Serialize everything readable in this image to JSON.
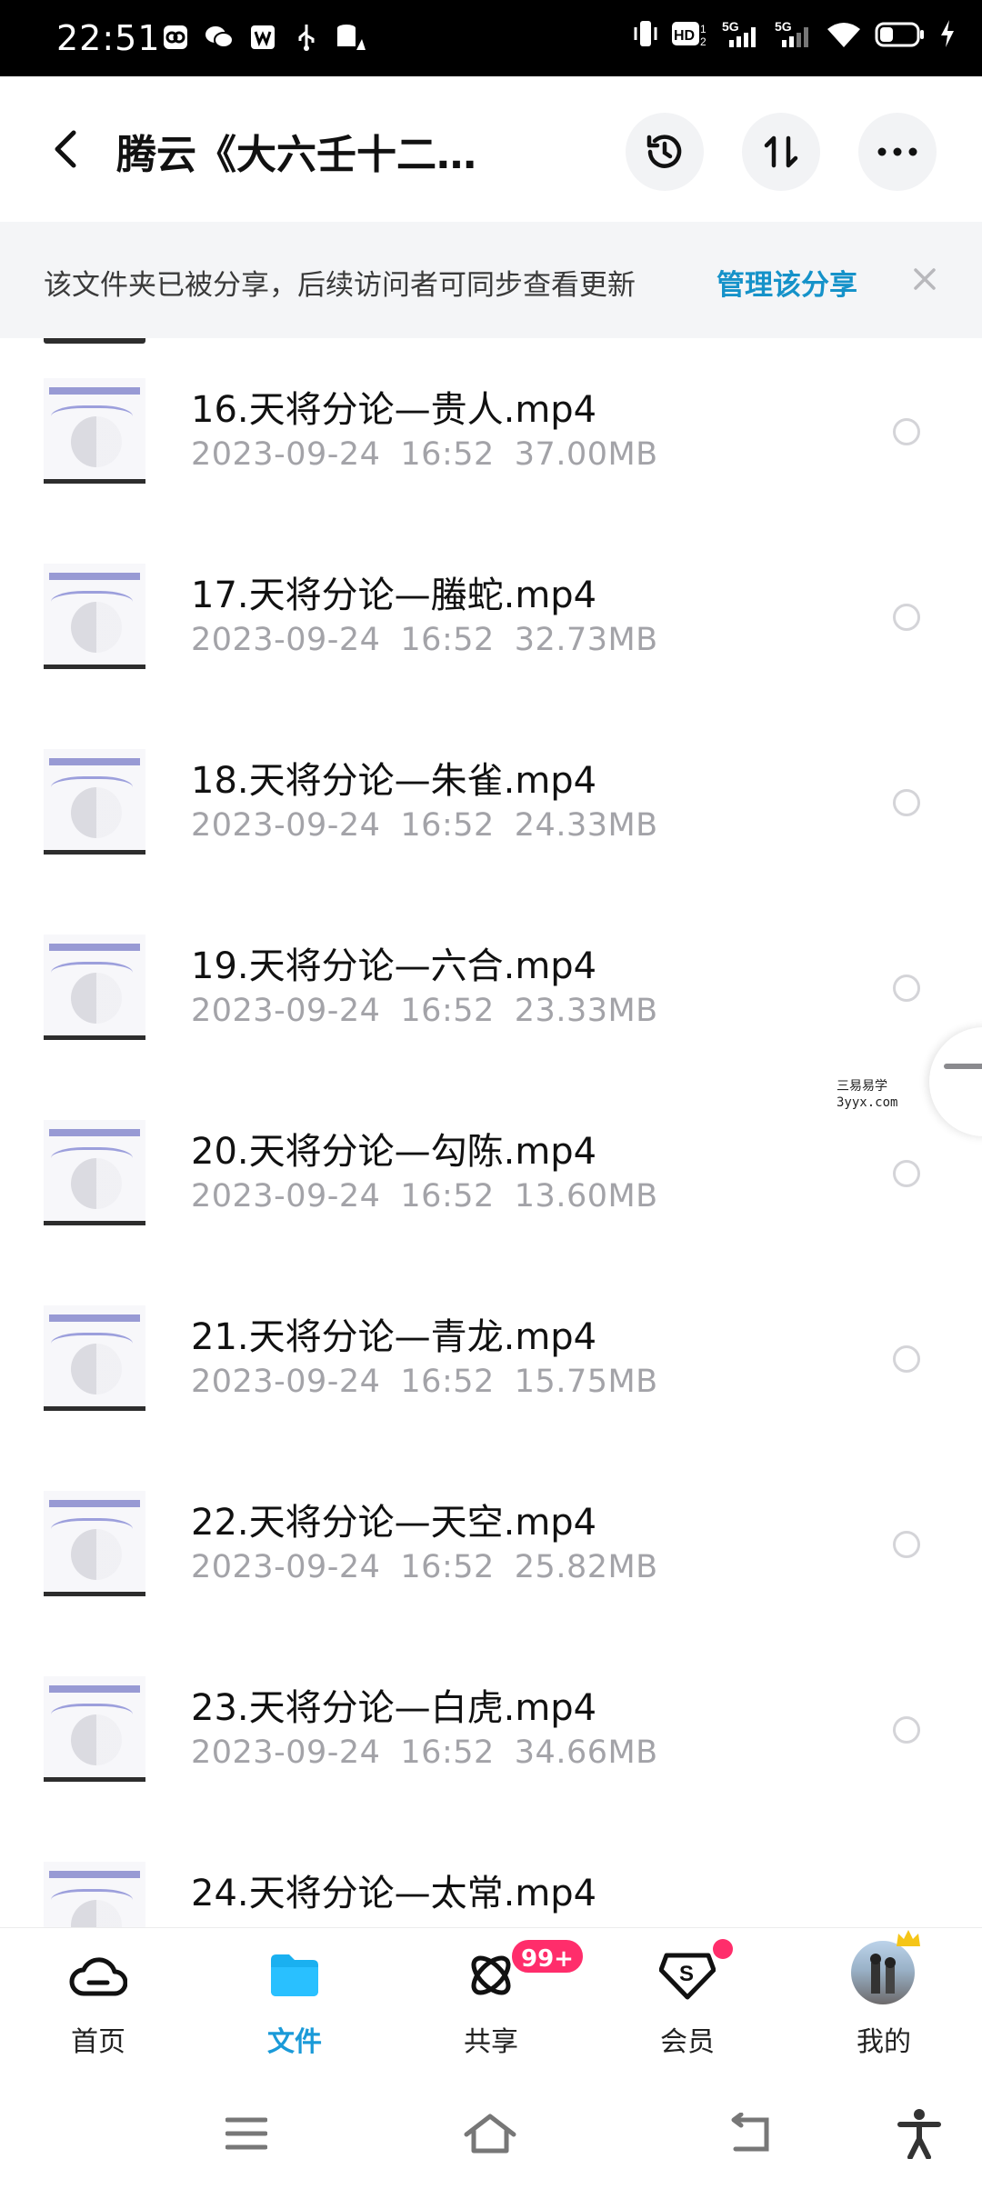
{
  "status_bar": {
    "time": "22:51",
    "left_icons": [
      "vpn-app-icon",
      "wechat-icon",
      "wps-icon",
      "usb-icon",
      "database-warning-icon"
    ],
    "right_icons": [
      "vibrate-icon",
      "hd-icon",
      "signal-5g-icon",
      "signal-5g-icon",
      "wifi-icon",
      "battery-icon",
      "charging-icon"
    ]
  },
  "header": {
    "title": "腾云《大六壬十二…",
    "buttons": [
      "history-icon",
      "sort-icon",
      "more-icon"
    ]
  },
  "share_banner": {
    "text": "该文件夹已被分享，后续访问者可同步查看更新",
    "link": "管理该分享"
  },
  "files": [
    {
      "name": "16.天将分论—贵人.mp4",
      "date": "2023-09-24",
      "time": "16:52",
      "size": "37.00MB"
    },
    {
      "name": "17.天将分论—螣蛇.mp4",
      "date": "2023-09-24",
      "time": "16:52",
      "size": "32.73MB"
    },
    {
      "name": "18.天将分论—朱雀.mp4",
      "date": "2023-09-24",
      "time": "16:52",
      "size": "24.33MB"
    },
    {
      "name": "19.天将分论—六合.mp4",
      "date": "2023-09-24",
      "time": "16:52",
      "size": "23.33MB"
    },
    {
      "name": "20.天将分论—勾陈.mp4",
      "date": "2023-09-24",
      "time": "16:52",
      "size": "13.60MB"
    },
    {
      "name": "21.天将分论—青龙.mp4",
      "date": "2023-09-24",
      "time": "16:52",
      "size": "15.75MB"
    },
    {
      "name": "22.天将分论—天空.mp4",
      "date": "2023-09-24",
      "time": "16:52",
      "size": "25.82MB"
    },
    {
      "name": "23.天将分论—白虎.mp4",
      "date": "2023-09-24",
      "time": "16:52",
      "size": "34.66MB"
    },
    {
      "name": "24.天将分论—太常.mp4",
      "date": "",
      "time": "",
      "size": ""
    }
  ],
  "watermark": {
    "line1": "三易易学",
    "line2": "3yyx.com"
  },
  "tabs": [
    {
      "label": "首页",
      "icon": "cloud-home-icon"
    },
    {
      "label": "文件",
      "icon": "folder-icon"
    },
    {
      "label": "共享",
      "icon": "share-orbit-icon",
      "badge": "99+"
    },
    {
      "label": "会员",
      "icon": "vip-diamond-icon"
    },
    {
      "label": "我的",
      "icon": "avatar"
    }
  ],
  "colors": {
    "accent": "#1a9ad8",
    "link": "#1592c9",
    "badge": "#ff2d6b"
  },
  "system_nav": [
    "menu-icon",
    "home-icon",
    "back-icon",
    "accessibility-icon"
  ]
}
